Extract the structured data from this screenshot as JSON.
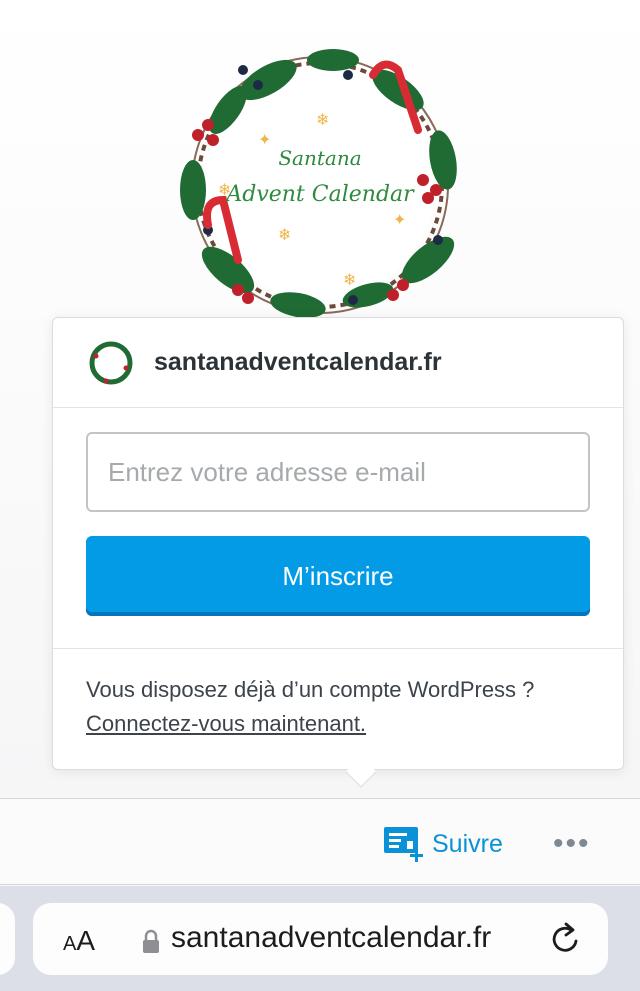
{
  "logo": {
    "line1": "Santana",
    "line2": "Advent Calendar"
  },
  "popover": {
    "site_name": "santanadventcalendar.fr",
    "email_placeholder": "Entrez votre adresse e-mail",
    "email_value": "",
    "submit_label": "M’inscrire",
    "footer_text": "Vous disposez déjà d’un compte WordPress ? ",
    "footer_link": "Connectez-vous maintenant."
  },
  "action_bar": {
    "follow_label": "Suivre",
    "follow_icon": "reader-follow-icon",
    "more_icon": "ellipsis-icon",
    "more_label": "•••"
  },
  "browser": {
    "text_size_small": "A",
    "text_size_big": "A",
    "url": "santanadventcalendar.fr",
    "lock_icon": "lock-icon",
    "reload_icon": "reload-icon"
  },
  "colors": {
    "accent": "#039be5",
    "follow_blue": "#0b92d6",
    "wreath_green": "#2e8b3e",
    "berry_red": "#c0202a"
  }
}
